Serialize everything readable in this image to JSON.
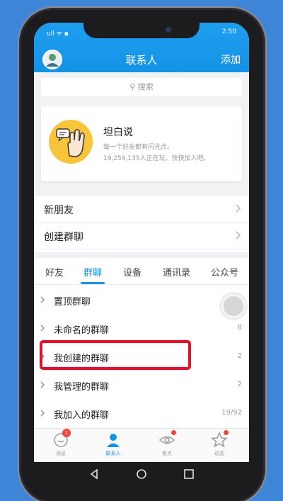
{
  "status_bar": {
    "left": "ull ᯤ ▪",
    "time": "2:50"
  },
  "header": {
    "title": "联系人",
    "add_label": "添加"
  },
  "search": {
    "placeholder": "搜索"
  },
  "card": {
    "title": "坦白说",
    "subtitle": "每一个好友都有闪光点。",
    "stats": "19,259,135人正在玩，快快加入吧。"
  },
  "menu_rows": [
    "新朋友",
    "创建群聊"
  ],
  "tabs": [
    {
      "label": "好友"
    },
    {
      "label": "群聊"
    },
    {
      "label": "设备"
    },
    {
      "label": "通讯录"
    },
    {
      "label": "公众号"
    }
  ],
  "groups": [
    {
      "label": "置顶群聊",
      "count": ""
    },
    {
      "label": "未命名的群聊",
      "count": "8"
    },
    {
      "label": "我创建的群聊",
      "count": "2"
    },
    {
      "label": "我管理的群聊",
      "count": "2"
    },
    {
      "label": "我加入的群聊",
      "count": "19/92"
    }
  ],
  "bottom_nav": [
    {
      "label": "消息",
      "icon": "message-icon",
      "badge": "1"
    },
    {
      "label": "联系人",
      "icon": "contacts-icon",
      "badge": ""
    },
    {
      "label": "看点",
      "icon": "eye-icon",
      "badge": ""
    },
    {
      "label": "动态",
      "icon": "star-icon",
      "badge": ""
    }
  ],
  "colors": {
    "accent": "#1593e6",
    "highlight": "#e0112a",
    "badge": "#f0473a"
  }
}
